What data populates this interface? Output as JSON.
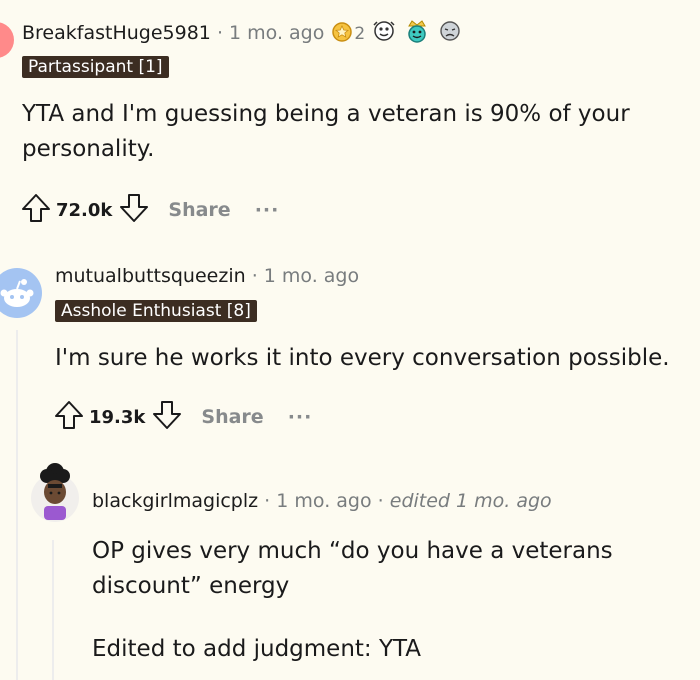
{
  "comments": [
    {
      "username": "BreakfastHuge5981",
      "time": "1 mo. ago",
      "award_count": "2",
      "awards": [
        "gold-award-icon",
        "wholesome-award-icon",
        "royal-award-icon",
        "sad-face-award-icon"
      ],
      "flair": "Partassipant [1]",
      "body": [
        "YTA and I'm guessing being a veteran is 90% of your",
        "personality."
      ],
      "score": "72.0k",
      "share_label": "Share",
      "more_label": "···"
    },
    {
      "username": "mutualbuttsqueezin",
      "time": "1 mo. ago",
      "flair": "Asshole Enthusiast [8]",
      "body": [
        "I'm sure he works it into every conversation possible."
      ],
      "score": "19.3k",
      "share_label": "Share",
      "more_label": "···"
    },
    {
      "username": "blackgirlmagicplz",
      "time": "1 mo. ago",
      "edited": "edited 1 mo. ago",
      "body": [
        "OP gives very much “do you have a veterans",
        "discount” energy"
      ],
      "body2": "Edited to add judgment: YTA"
    }
  ],
  "separator": "·",
  "colors": {
    "background": "#fdfbf1",
    "flair_bg": "#3c2d22",
    "snoo_avatar": "#a4c4f2",
    "partial_avatar": "#ff8a8a",
    "meta_gray": "#787c7e"
  }
}
